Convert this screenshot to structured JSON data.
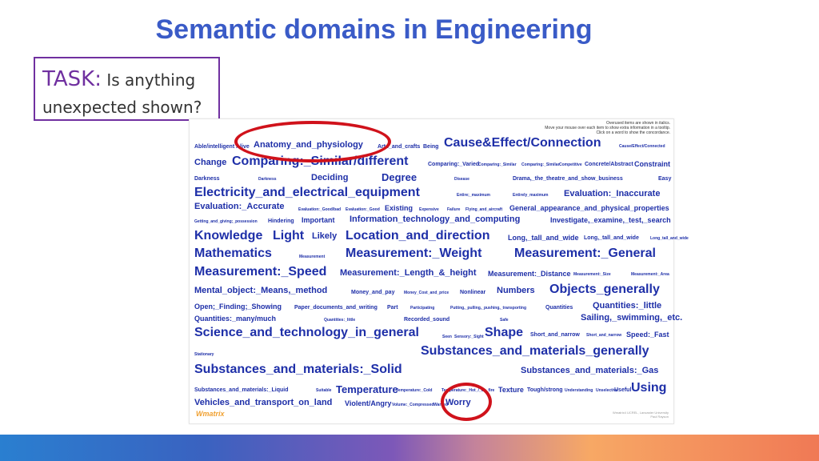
{
  "slide": {
    "title": "Semantic domains in Engineering",
    "task_lead": "TASK:",
    "task_text": " Is anything unexpected shown?"
  },
  "cloud": {
    "instructions": [
      "Overused items are shown in italics.",
      "Move your mouse over each item to show extra information in a tooltip.",
      "Click on a word to show the concordance."
    ],
    "logo": "Wmatrix",
    "credit": [
      "Wmatrix4 UCREL, Lancaster University",
      "Paul Rayson"
    ],
    "words": [
      "Able/intelligent",
      "Alive",
      "Anatomy_and_physiology",
      "Arts_and_crafts",
      "Being",
      "Cause&Effect/Connection",
      "Cause/Effect/Connected",
      "Change",
      "Comparing:_Similar/different",
      "Comparing:_Varied",
      "Comparing:_Similar",
      "Comparing:_Similar",
      "Competitive",
      "Concrete/Abstract",
      "Constraint",
      "Darkness",
      "Darkness",
      "Deciding",
      "Degree",
      "Disease",
      "Drama,_the_theatre_and_show_business",
      "Easy",
      "Electricity_and_electrical_equipment",
      "Entire;_maximum",
      "Entirely_maximum",
      "Evaluation:_Inaccurate",
      "Evaluation:_Accurate",
      "Evaluation:_Good/bad",
      "Evaluation:_Good",
      "Existing",
      "Expensive",
      "Failure",
      "Flying_and_aircraft",
      "General_appearance_and_physical_properties",
      "Getting_and_giving;_possession",
      "Hindering",
      "Important",
      "Information_technology_and_computing",
      "Investigate,_examine,_test,_search",
      "Knowledge",
      "Light",
      "Likely",
      "Location_and_direction",
      "Long,_tall_and_wide",
      "Long,_tall_and_wide",
      "Long_tall_and_wide",
      "Mathematics",
      "Measurement",
      "Measurement:_Weight",
      "Measurement:_General",
      "Measurement:_Speed",
      "Measurement:_Length_&_height",
      "Measurement:_Distance",
      "Measurement:_Size",
      "Measurement:_Area",
      "Mental_object:_Means,_method",
      "Money_and_pay",
      "Money_Cost_and_price",
      "Nonlinear",
      "Numbers",
      "Objects_generally",
      "Open;_Finding;_Showing",
      "Paper_documents_and_writing",
      "Part",
      "Participating",
      "Putting,_pulling,_pushing,_transporting",
      "Quantities",
      "Quantities:_little",
      "Quantities:_many/much",
      "Quantities:_little",
      "Recorded_sound",
      "Safe",
      "Sailing,_swimming,_etc.",
      "Science_and_technology_in_general",
      "Seen",
      "Sensory:_Sight",
      "Shape",
      "Short_and_narrow",
      "Short_and_narrow",
      "Speed:_Fast",
      "Stationary",
      "Substances_and_materials_generally",
      "Substances_and_materials:_Solid",
      "Substances_and_materials:_Gas",
      "Substances_and_materials:_Liquid",
      "Suitable",
      "Temperature",
      "Temperature:_Cold",
      "Temperature:_Hot_/_on_fire",
      "Texture",
      "Tough/strong",
      "Understanding",
      "Unselective",
      "Useful",
      "Using",
      "Vehicles_and_transport_on_land",
      "Violent/Angry",
      "Volume:_Compressed",
      "Wanted",
      "Worry"
    ]
  }
}
